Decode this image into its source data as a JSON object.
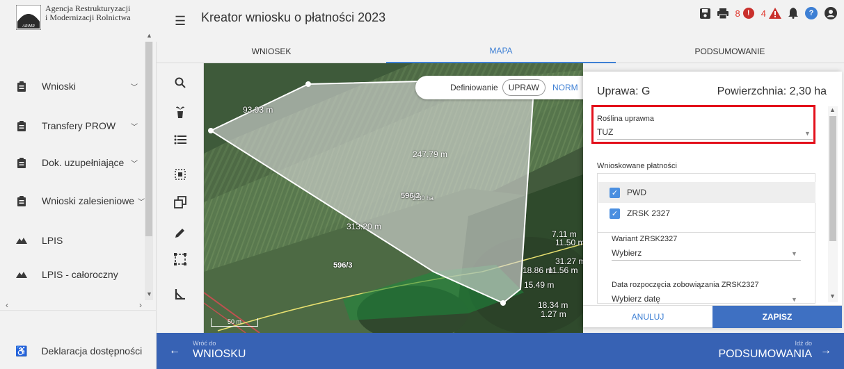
{
  "logo": {
    "line1": "Agencja Restrukturyzacji",
    "line2": "i Modernizacji Rolnictwa",
    "mark_text": "ARiMR"
  },
  "header": {
    "title": "Kreator wniosku o płatności 2023",
    "error_count": "8",
    "warning_count": "4",
    "error_symbol": "!",
    "warning_symbol": "!",
    "help_symbol": "?"
  },
  "tabs": [
    {
      "label": "WNIOSEK"
    },
    {
      "label": "MAPA"
    },
    {
      "label": "PODSUMOWANIE"
    }
  ],
  "sidebar": {
    "items": [
      {
        "label": "Wnioski",
        "icon": "clipboard-icon"
      },
      {
        "label": "Transfery PROW",
        "icon": "clipboard-icon"
      },
      {
        "label": "Dok. uzupełniające",
        "icon": "clipboard-icon"
      },
      {
        "label": "Wnioski zalesieniowe",
        "icon": "clipboard-icon"
      },
      {
        "label": "LPIS",
        "icon": "mountain-icon"
      },
      {
        "label": "LPIS - całoroczny",
        "icon": "mountain-icon"
      }
    ],
    "declaration": "Deklaracja dostępności"
  },
  "map": {
    "define_label": "Definiowanie",
    "define_opt1": "UPRAW",
    "define_opt2": "NORM",
    "labels": {
      "l1": "93.93 m",
      "l2": "247.79 m",
      "l3": "313.20 m",
      "l4": "596/2",
      "l4b": "2.30 ha",
      "l5": "596/3",
      "l6": "7.11 m",
      "l7": "11.50 m",
      "l8": "31.27 m",
      "l9": "18.86 m",
      "l10": "11.56 m",
      "l11": "15.49 m",
      "l12": "18.34 m",
      "l13": "1.27 m",
      "scale": "50 m"
    }
  },
  "panel": {
    "title_left": "Uprawa: G",
    "title_right": "Powierzchnia: 2,30 ha",
    "crop_label": "Roślina uprawna",
    "crop_value": "TUZ",
    "payments_label": "Wnioskowane płatności",
    "payments": [
      {
        "name": "PWD",
        "checked": true
      },
      {
        "name": "ZRSK 2327",
        "checked": true
      }
    ],
    "variant_label": "Wariant ZRSK2327",
    "variant_value": "Wybierz",
    "date_label": "Data rozpoczęcia zobowiązania ZRSK2327",
    "date_value": "Wybierz datę",
    "cancel": "ANULUJ",
    "save": "ZAPISZ"
  },
  "bottom": {
    "back_small": "Wróć do",
    "back_big": "WNIOSKU",
    "next_small": "Idź do",
    "next_big": "PODSUMOWANIA"
  },
  "colors": {
    "accent": "#3d7fd4",
    "nav_blue": "#3762b4",
    "highlight_red": "#e3101b",
    "error_red": "#e0352b",
    "warning_red": "#c9302c"
  }
}
